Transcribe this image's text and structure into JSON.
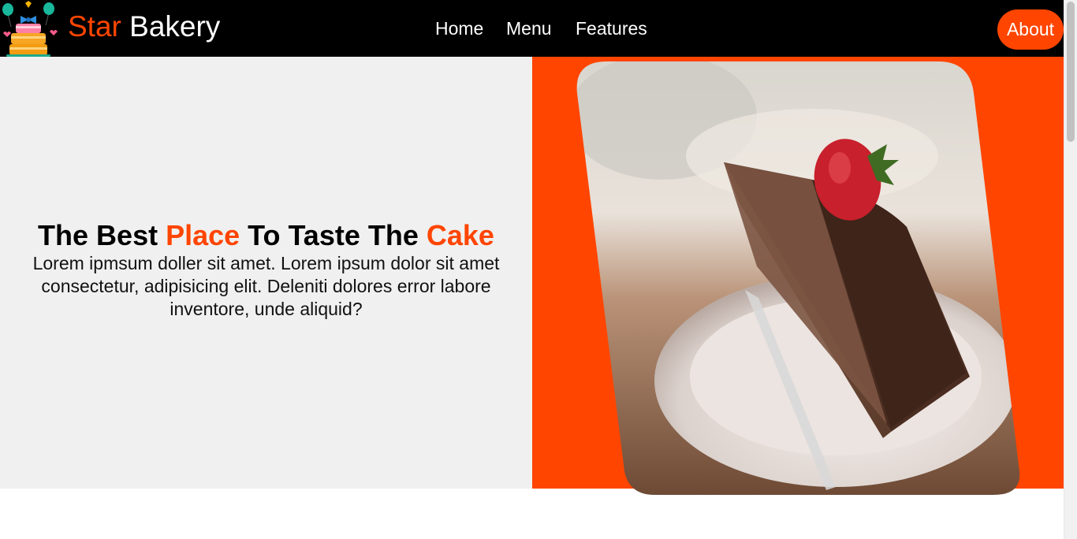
{
  "header": {
    "brand_first": "Star",
    "brand_second": "Bakery",
    "nav": {
      "home": "Home",
      "menu": "Menu",
      "features": "Features",
      "about": "About"
    }
  },
  "hero": {
    "title_parts": [
      "The Best ",
      "Place",
      " To Taste The ",
      "Cake"
    ],
    "paragraph": "Lorem ipmsum doller sit amet. Lorem ipsum dolor sit amet consectetur, adipisicing elit. Deleniti dolores error labore inventore, unde aliquid?"
  },
  "colors": {
    "accent": "#ff4500",
    "header_bg": "#000000",
    "hero_left_bg": "#f0f0f0"
  },
  "icons": {
    "logo": "birthday-cake-with-balloons-icon"
  }
}
